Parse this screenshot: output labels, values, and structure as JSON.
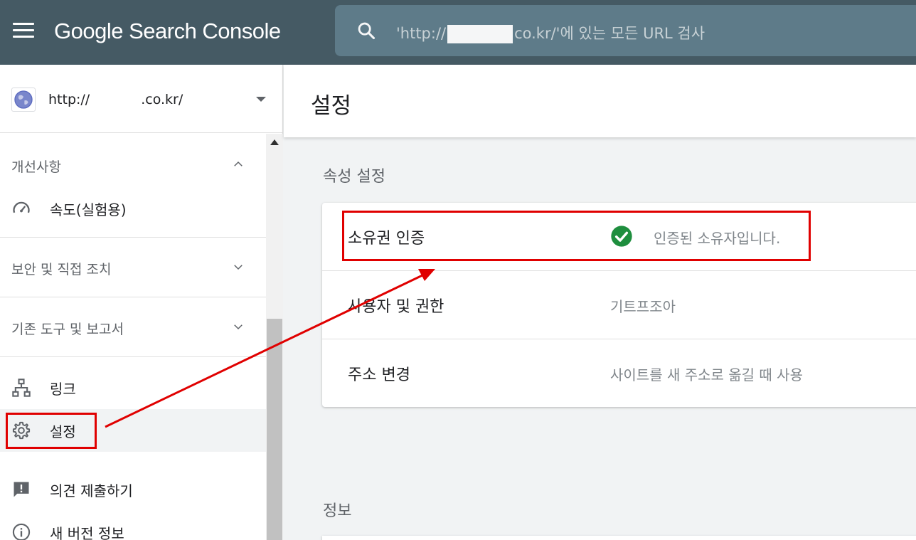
{
  "topbar": {
    "brand_google": "Google",
    "brand_product": " Search Console",
    "search_prefix": "'http://",
    "search_suffix": "co.kr/'에 있는 모든 URL 검사"
  },
  "property": {
    "url_prefix": "http://",
    "url_suffix": ".co.kr/"
  },
  "sidebar": {
    "sections": [
      {
        "label": "개선사항"
      },
      {
        "label": "보안 및 직접 조치"
      },
      {
        "label": "기존 도구 및 보고서"
      }
    ],
    "items": [
      {
        "label": "속도(실험용)"
      },
      {
        "label": "링크"
      },
      {
        "label": "설정"
      },
      {
        "label": "의견 제출하기"
      },
      {
        "label": "새 버전 정보"
      }
    ]
  },
  "main": {
    "title": "설정",
    "section_title": "속성 설정",
    "rows": [
      {
        "key": "소유권 인증",
        "value": "인증된 소유자입니다."
      },
      {
        "key": "사용자 및 권한",
        "value": "기트프조아"
      },
      {
        "key": "주소 변경",
        "value": "사이트를 새 주소로 옮길 때 사용"
      }
    ],
    "info_title": "정보"
  },
  "colors": {
    "topbar": "#455a64",
    "search": "#607d8b",
    "check": "#1e8e3e",
    "highlight": "#e00000"
  }
}
